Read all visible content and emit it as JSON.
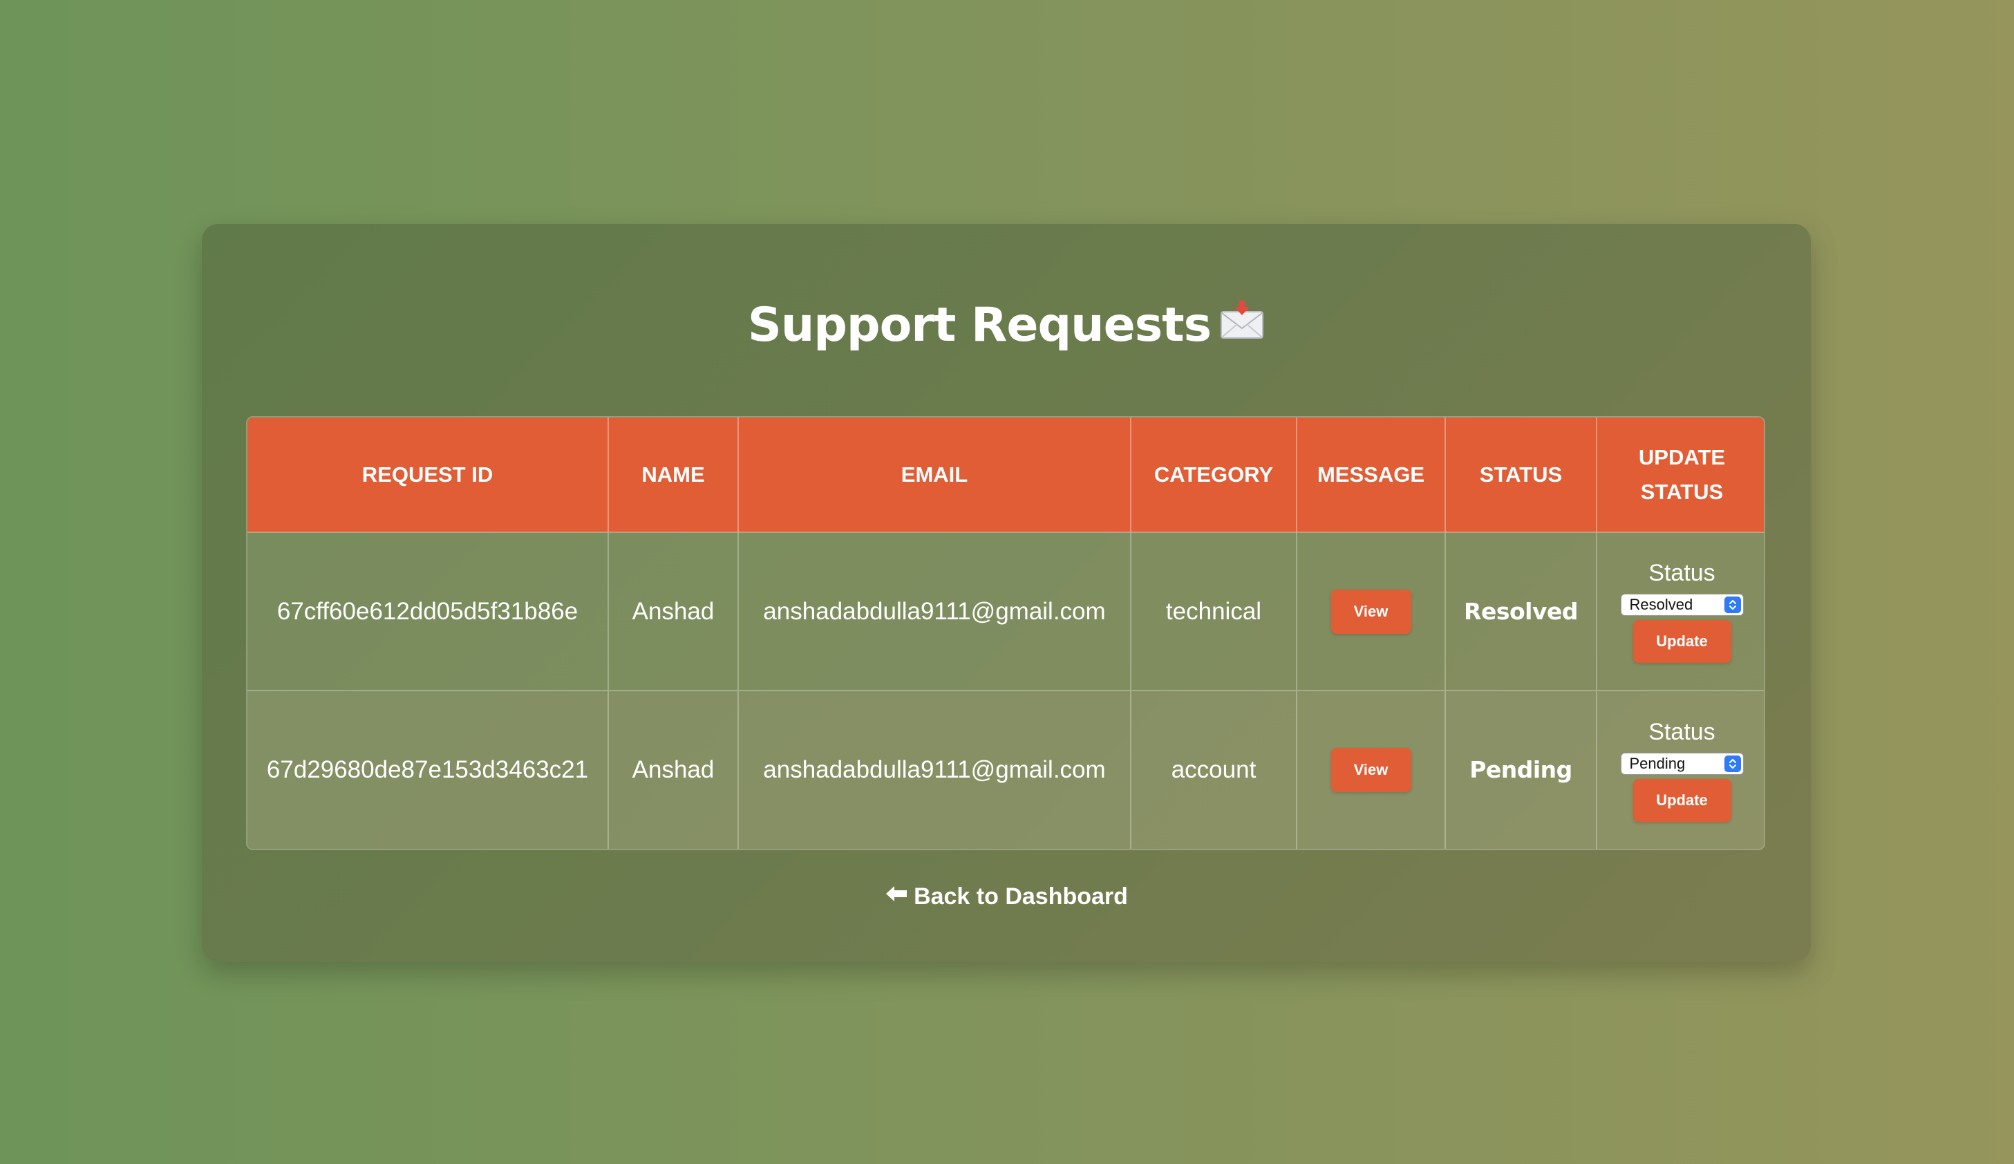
{
  "page": {
    "title": "Support Requests",
    "title_icon": "incoming-envelope-icon",
    "back_link_icon": "left-arrow-icon",
    "back_link_label": "Back to Dashboard"
  },
  "table": {
    "headers": {
      "request_id": "REQUEST ID",
      "name": "NAME",
      "email": "EMAIL",
      "category": "CATEGORY",
      "message": "MESSAGE",
      "status": "STATUS",
      "update_status": "UPDATE STATUS"
    },
    "rows": [
      {
        "request_id": "67cff60e612dd05d5f31b86e",
        "name": "Anshad",
        "email": "anshadabdulla9111@gmail.com",
        "category": "technical",
        "view_label": "View",
        "status": "Resolved",
        "update_label": "Status",
        "select_value": "Resolved",
        "update_button": "Update"
      },
      {
        "request_id": "67d29680de87e153d3463c21",
        "name": "Anshad",
        "email": "anshadabdulla9111@gmail.com",
        "category": "account",
        "view_label": "View",
        "status": "Pending",
        "update_label": "Status",
        "select_value": "Pending",
        "update_button": "Update"
      }
    ]
  },
  "colors": {
    "accent": "#e05d35",
    "select_arrow": "#2f7bf5"
  }
}
